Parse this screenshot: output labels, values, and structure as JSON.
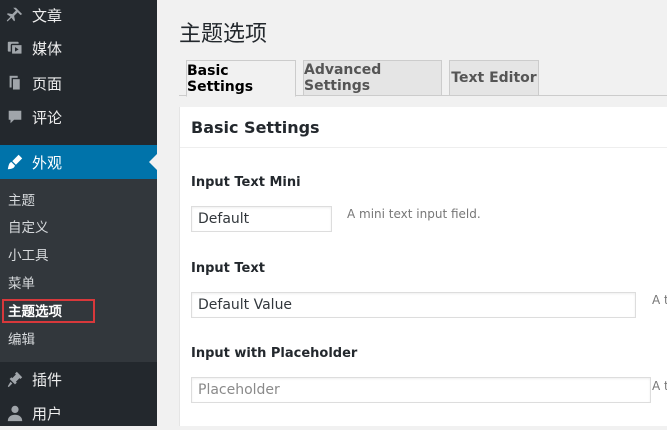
{
  "sidebar": {
    "items": [
      {
        "label": "文章",
        "icon": "pin-icon"
      },
      {
        "label": "媒体",
        "icon": "media-icon"
      },
      {
        "label": "页面",
        "icon": "page-icon"
      },
      {
        "label": "评论",
        "icon": "comment-icon"
      },
      {
        "label": "外观",
        "icon": "brush-icon",
        "active": true
      },
      {
        "label": "插件",
        "icon": "plugin-icon"
      },
      {
        "label": "用户",
        "icon": "user-icon"
      }
    ],
    "submenu": [
      "主题",
      "自定义",
      "小工具",
      "菜单",
      "主题选项",
      "编辑"
    ],
    "current_submenu": "主题选项"
  },
  "page": {
    "title": "主题选项",
    "tabs": [
      "Basic Settings",
      "Advanced Settings",
      "Text Editor"
    ],
    "active_tab": "Basic Settings"
  },
  "panel": {
    "title": "Basic Settings",
    "fields": [
      {
        "label": "Input Text Mini",
        "value": "Default",
        "description": "A mini text input field."
      },
      {
        "label": "Input Text",
        "value": "Default Value",
        "description": "A t"
      },
      {
        "label": "Input with Placeholder",
        "value": "",
        "placeholder": "Placeholder",
        "description": "A t"
      }
    ]
  },
  "colors": {
    "sidebar_bg": "#23282d",
    "submenu_bg": "#32373c",
    "active_bg": "#0073aa",
    "highlight_border": "#d8383b"
  }
}
